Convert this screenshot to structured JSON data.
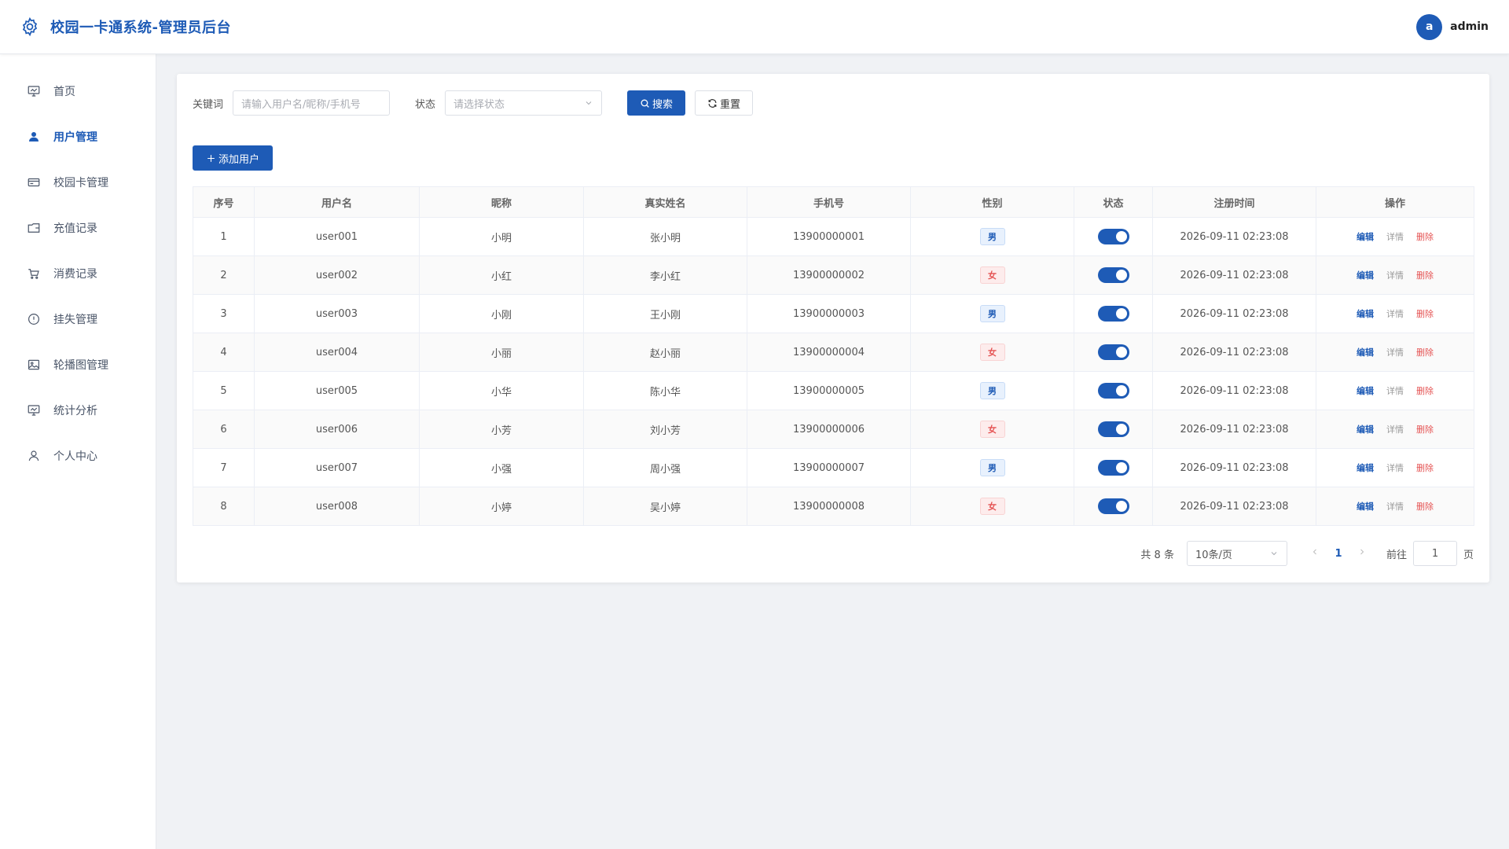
{
  "header": {
    "title": "校园一卡通系统-管理员后台",
    "avatar_letter": "a",
    "username": "admin"
  },
  "sidebar": {
    "items": [
      {
        "label": "首页",
        "icon": "monitor-icon",
        "active": false
      },
      {
        "label": "用户管理",
        "icon": "user-icon",
        "active": true
      },
      {
        "label": "校园卡管理",
        "icon": "card-icon",
        "active": false
      },
      {
        "label": "充值记录",
        "icon": "wallet-icon",
        "active": false
      },
      {
        "label": "消费记录",
        "icon": "cart-icon",
        "active": false
      },
      {
        "label": "挂失管理",
        "icon": "warning-icon",
        "active": false
      },
      {
        "label": "轮播图管理",
        "icon": "picture-icon",
        "active": false
      },
      {
        "label": "统计分析",
        "icon": "chart-icon",
        "active": false
      },
      {
        "label": "个人中心",
        "icon": "person-icon",
        "active": false
      }
    ]
  },
  "filters": {
    "keyword_label": "关键词",
    "keyword_placeholder": "请输入用户名/昵称/手机号",
    "status_label": "状态",
    "status_placeholder": "请选择状态",
    "search_label": "搜索",
    "reset_label": "重置"
  },
  "add_user_label": "添加用户",
  "table": {
    "headers": [
      "序号",
      "用户名",
      "昵称",
      "真实姓名",
      "手机号",
      "性别",
      "状态",
      "注册时间",
      "操作"
    ],
    "rows": [
      {
        "index": "1",
        "username": "user001",
        "nickname": "小明",
        "realname": "张小明",
        "phone": "13900000001",
        "gender": "男",
        "status_on": true,
        "registered": "2026-09-11 02:23:08"
      },
      {
        "index": "2",
        "username": "user002",
        "nickname": "小红",
        "realname": "李小红",
        "phone": "13900000002",
        "gender": "女",
        "status_on": true,
        "registered": "2026-09-11 02:23:08"
      },
      {
        "index": "3",
        "username": "user003",
        "nickname": "小刚",
        "realname": "王小刚",
        "phone": "13900000003",
        "gender": "男",
        "status_on": true,
        "registered": "2026-09-11 02:23:08"
      },
      {
        "index": "4",
        "username": "user004",
        "nickname": "小丽",
        "realname": "赵小丽",
        "phone": "13900000004",
        "gender": "女",
        "status_on": true,
        "registered": "2026-09-11 02:23:08"
      },
      {
        "index": "5",
        "username": "user005",
        "nickname": "小华",
        "realname": "陈小华",
        "phone": "13900000005",
        "gender": "男",
        "status_on": true,
        "registered": "2026-09-11 02:23:08"
      },
      {
        "index": "6",
        "username": "user006",
        "nickname": "小芳",
        "realname": "刘小芳",
        "phone": "13900000006",
        "gender": "女",
        "status_on": true,
        "registered": "2026-09-11 02:23:08"
      },
      {
        "index": "7",
        "username": "user007",
        "nickname": "小强",
        "realname": "周小强",
        "phone": "13900000007",
        "gender": "男",
        "status_on": true,
        "registered": "2026-09-11 02:23:08"
      },
      {
        "index": "8",
        "username": "user008",
        "nickname": "小婷",
        "realname": "吴小婷",
        "phone": "13900000008",
        "gender": "女",
        "status_on": true,
        "registered": "2026-09-11 02:23:08"
      }
    ],
    "actions": {
      "edit": "编辑",
      "detail": "详情",
      "delete": "删除"
    }
  },
  "pagination": {
    "total_text": "共 8 条",
    "page_size": "10条/页",
    "current_page": "1",
    "goto_label": "前往",
    "goto_value": "1",
    "page_unit": "页"
  },
  "colors": {
    "primary": "#1e5bb6",
    "danger": "#e55353",
    "background": "#f0f2f5"
  }
}
